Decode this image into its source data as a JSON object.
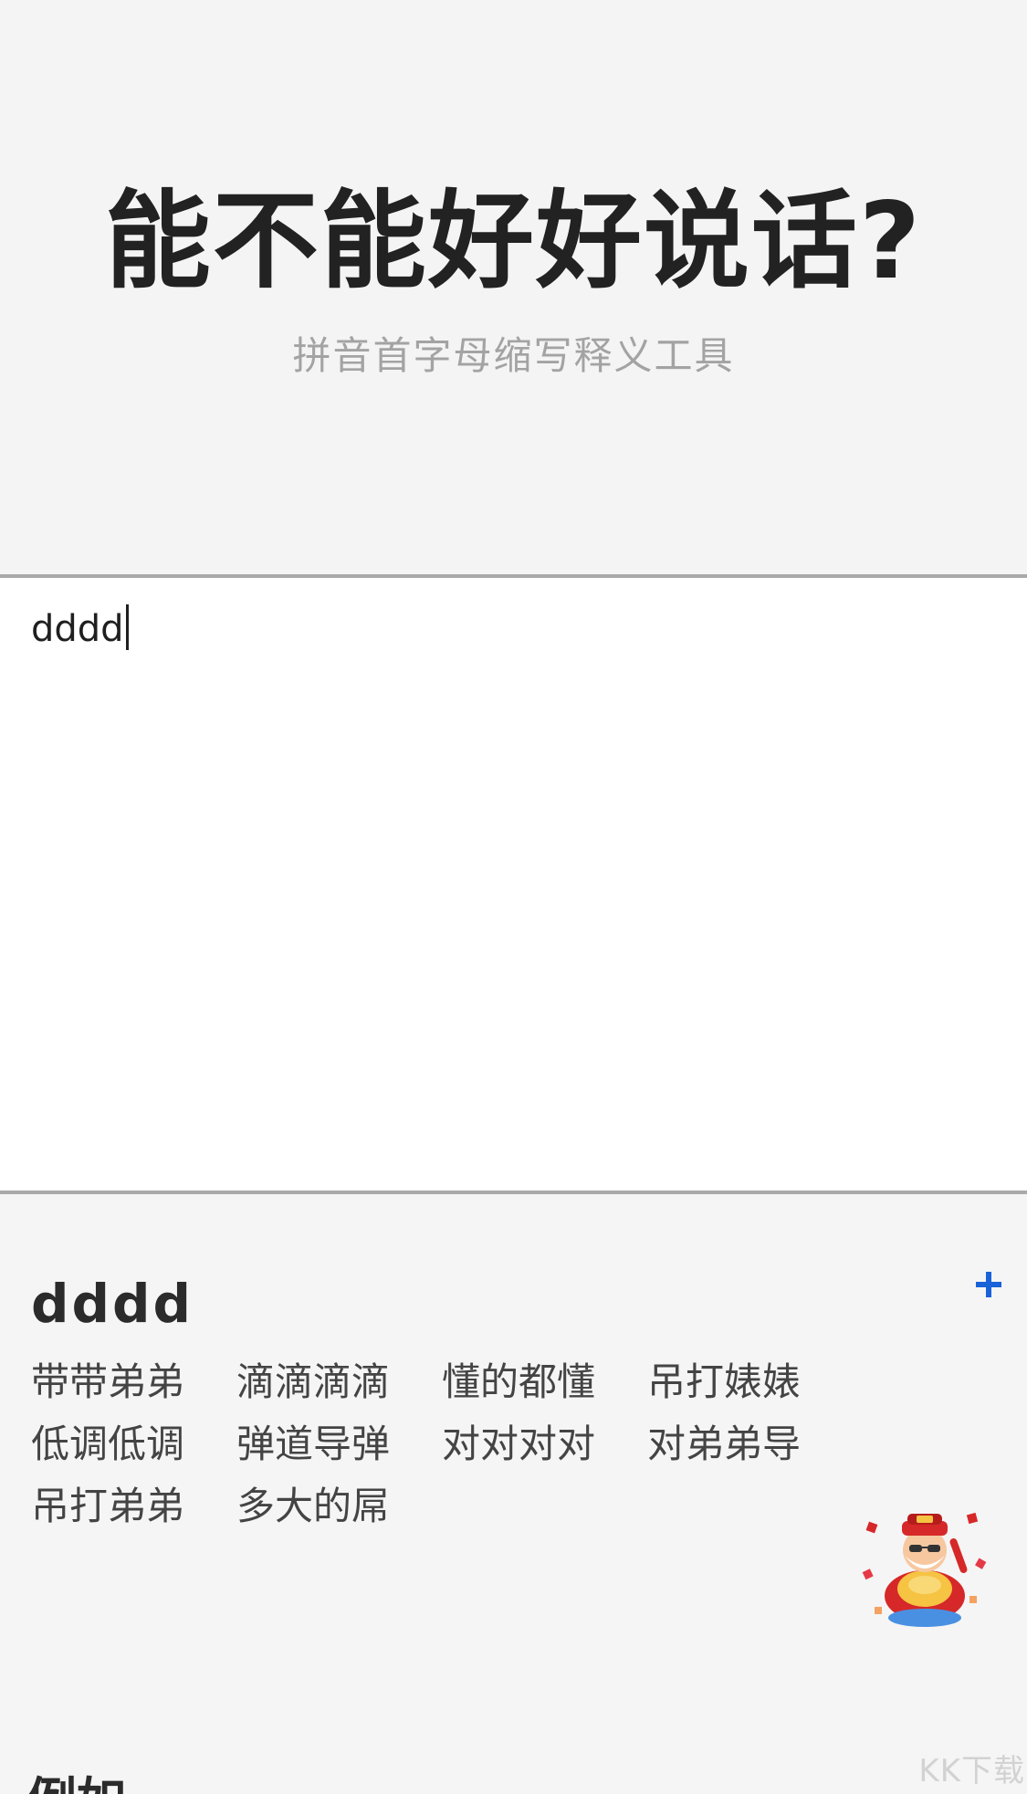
{
  "header": {
    "title": "能不能好好说话?",
    "subtitle": "拼音首字母缩写释义工具"
  },
  "input": {
    "value": "dddd"
  },
  "result": {
    "term": "dddd",
    "candidates": [
      "带带弟弟",
      "滴滴滴滴",
      "懂的都懂",
      "吊打婊婊",
      "低调低调",
      "弹道导弹",
      "对对对对",
      "对弟弟导",
      "吊打弟弟",
      "多大的屌"
    ]
  },
  "next_section": {
    "heading": "例如"
  },
  "watermark": "KK下载",
  "icons": {
    "add": "plus-icon",
    "mascot": "fortune-god-sticker"
  },
  "colors": {
    "accent": "#1a62d8",
    "divider": "#a9a9a9",
    "background": "#f5f5f5"
  }
}
